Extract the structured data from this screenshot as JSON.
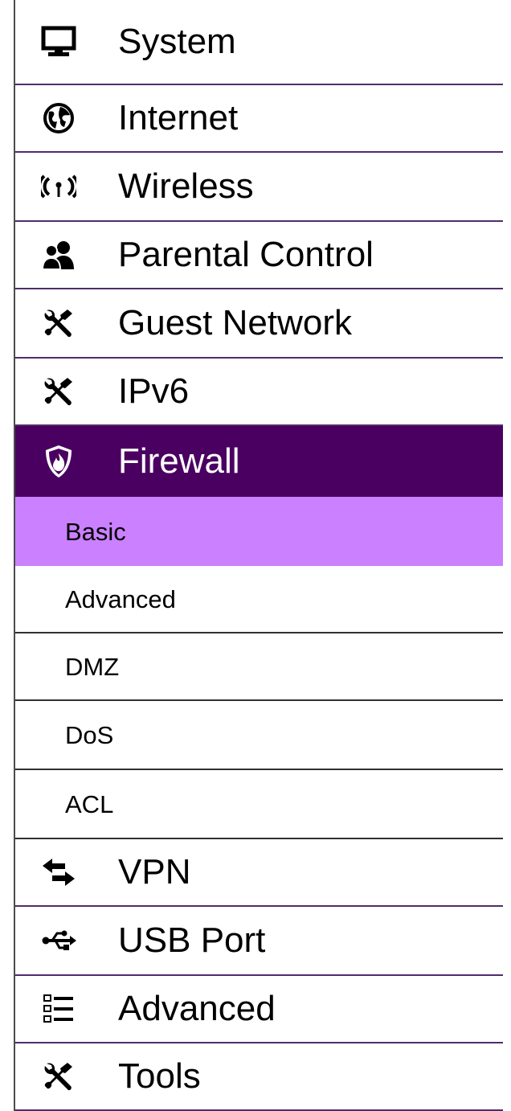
{
  "sidebar": {
    "items": [
      {
        "label": "System",
        "icon": "monitor-icon"
      },
      {
        "label": "Internet",
        "icon": "globe-icon"
      },
      {
        "label": "Wireless",
        "icon": "wireless-signal-icon"
      },
      {
        "label": "Parental Control",
        "icon": "users-icon"
      },
      {
        "label": "Guest Network",
        "icon": "tools-icon"
      },
      {
        "label": "IPv6",
        "icon": "tools-icon"
      },
      {
        "label": "Firewall",
        "icon": "firewall-shield-icon",
        "state": "expanded"
      },
      {
        "label": "VPN",
        "icon": "exchange-arrows-icon"
      },
      {
        "label": "USB Port",
        "icon": "usb-icon"
      },
      {
        "label": "Advanced",
        "icon": "list-icon"
      },
      {
        "label": "Tools",
        "icon": "tools-icon"
      }
    ],
    "firewall_submenu": [
      {
        "label": "Basic",
        "state": "selected"
      },
      {
        "label": "Advanced"
      },
      {
        "label": "DMZ"
      },
      {
        "label": "DoS"
      },
      {
        "label": "ACL"
      }
    ]
  },
  "colors": {
    "active_background": "#4a0060",
    "selected_background": "#ca80ff",
    "divider": "#4e2d6b"
  }
}
